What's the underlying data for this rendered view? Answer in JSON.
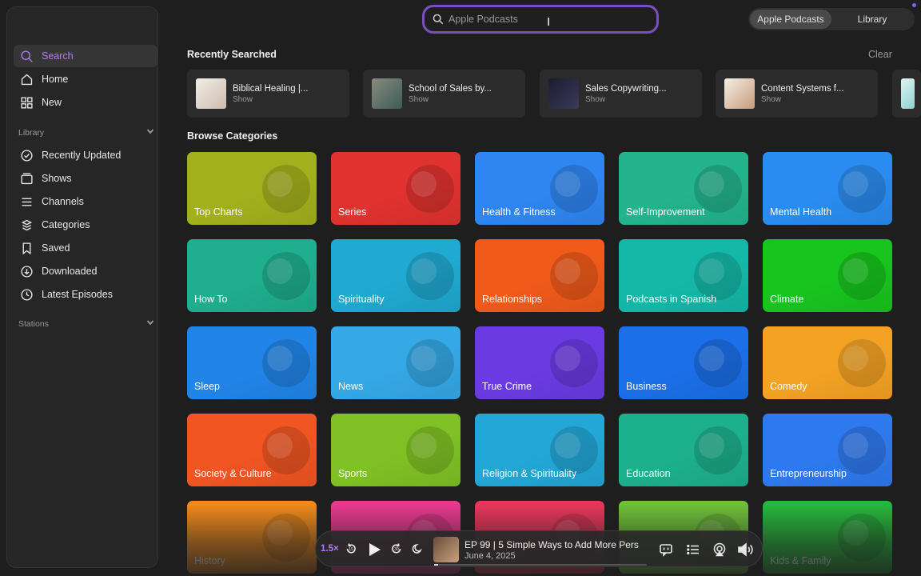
{
  "sidebar": {
    "search_label": "Search",
    "home_label": "Home",
    "new_label": "New",
    "library_header": "Library",
    "library_items": [
      "Recently Updated",
      "Shows",
      "Channels",
      "Categories",
      "Saved",
      "Downloaded",
      "Latest Episodes"
    ],
    "stations_header": "Stations"
  },
  "search": {
    "placeholder": "Apple Podcasts"
  },
  "segmented": {
    "option1": "Apple Podcasts",
    "option2": "Library",
    "selected": "Apple Podcasts"
  },
  "recent": {
    "title": "Recently Searched",
    "clear_label": "Clear",
    "items": [
      {
        "title": "Biblical Healing |...",
        "subtitle": "Show"
      },
      {
        "title": "School of Sales by...",
        "subtitle": "Show"
      },
      {
        "title": "Sales Copywriting...",
        "subtitle": "Show"
      },
      {
        "title": "Content Systems f...",
        "subtitle": "Show"
      }
    ]
  },
  "browse": {
    "title": "Browse Categories",
    "categories": [
      {
        "name": "Top Charts",
        "color": "#a3b01d"
      },
      {
        "name": "Series",
        "color": "#e0322f"
      },
      {
        "name": "Health & Fitness",
        "color": "#2f86f2"
      },
      {
        "name": "Self-Improvement",
        "color": "#23b48d"
      },
      {
        "name": "Mental Health",
        "color": "#2a8cf0"
      },
      {
        "name": "How To",
        "color": "#1fae8e"
      },
      {
        "name": "Spirituality",
        "color": "#20a9d1"
      },
      {
        "name": "Relationships",
        "color": "#f05a1a"
      },
      {
        "name": "Podcasts in Spanish",
        "color": "#14b8a8"
      },
      {
        "name": "Climate",
        "color": "#18c41e"
      },
      {
        "name": "Sleep",
        "color": "#2185e8"
      },
      {
        "name": "News",
        "color": "#35a8e6"
      },
      {
        "name": "True Crime",
        "color": "#6a3be3"
      },
      {
        "name": "Business",
        "color": "#1b6fe8"
      },
      {
        "name": "Comedy",
        "color": "#f4a223"
      },
      {
        "name": "Society & Culture",
        "color": "#f05522"
      },
      {
        "name": "Sports",
        "color": "#7fc124"
      },
      {
        "name": "Religion & Spirituality",
        "color": "#23a7d6"
      },
      {
        "name": "Education",
        "color": "#1db08d"
      },
      {
        "name": "Entrepreneurship",
        "color": "#2f79ee"
      },
      {
        "name": "History",
        "color": "#f08a1c"
      },
      {
        "name": "",
        "color": "#e8398f"
      },
      {
        "name": "",
        "color": "#e8365a"
      },
      {
        "name": "",
        "color": "#6fc13a"
      },
      {
        "name": "Kids & Family",
        "color": "#27b83c"
      }
    ]
  },
  "player": {
    "speed": "1.5×",
    "skip_back": "15",
    "skip_forward": "30",
    "episode_title": "EP 99 | 5 Simple Ways to Add More Pers",
    "episode_date": "June 4, 2025",
    "progress": 0.02
  }
}
